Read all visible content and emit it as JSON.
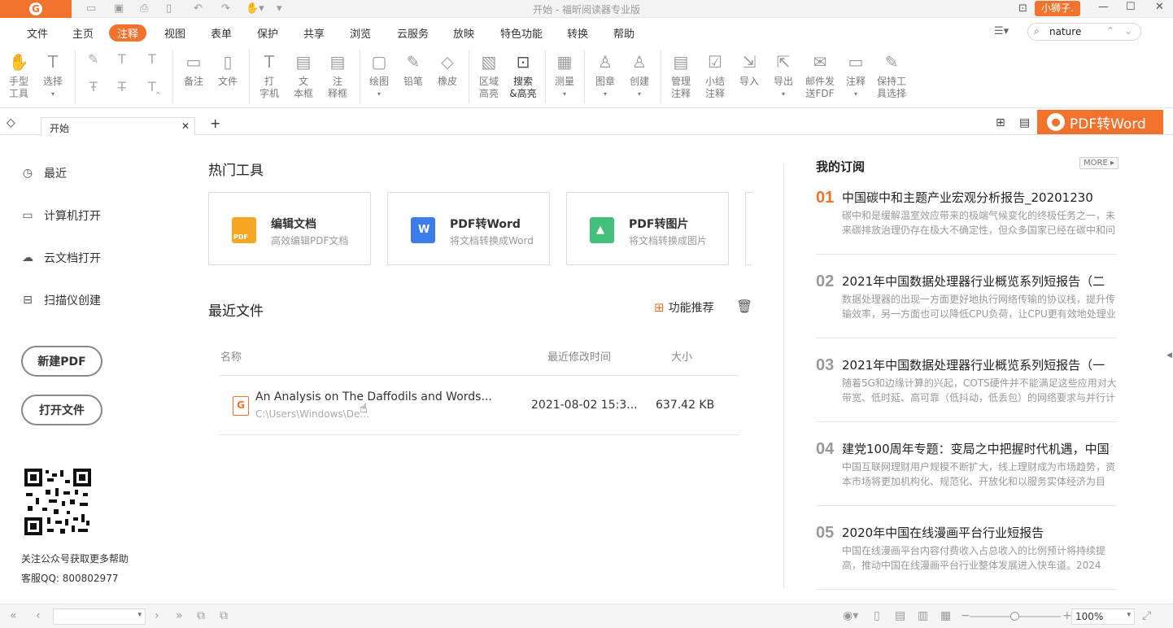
{
  "window": {
    "title": "开始 - 福昕阅读器专业版",
    "user": "小狮子."
  },
  "menu": {
    "items": [
      "文件",
      "主页",
      "注释",
      "视图",
      "表单",
      "保护",
      "共享",
      "浏览",
      "云服务",
      "放映",
      "特色功能",
      "转换",
      "帮助"
    ],
    "active": "注释",
    "search_value": "nature"
  },
  "ribbon": {
    "tools": [
      {
        "label": "手型\n工具",
        "icon": "hand-icon"
      },
      {
        "label": "选择",
        "icon": "select-text-icon"
      },
      {
        "label": "备注",
        "icon": "note-icon"
      },
      {
        "label": "文件",
        "icon": "file-attach-icon"
      },
      {
        "label": "打\n字机",
        "icon": "typewriter-icon"
      },
      {
        "label": "文\n本框",
        "icon": "textbox-icon"
      },
      {
        "label": "注\n释框",
        "icon": "callout-icon"
      },
      {
        "label": "绘图",
        "icon": "drawing-icon"
      },
      {
        "label": "铅笔",
        "icon": "pencil-icon"
      },
      {
        "label": "橡皮",
        "icon": "eraser-icon"
      },
      {
        "label": "区域\n高亮",
        "icon": "area-highlight-icon"
      },
      {
        "label": "搜索\n&高亮",
        "icon": "search-highlight-icon"
      },
      {
        "label": "测量",
        "icon": "measure-icon"
      },
      {
        "label": "图章",
        "icon": "stamp-icon"
      },
      {
        "label": "创建",
        "icon": "create-stamp-icon"
      },
      {
        "label": "管理\n注释",
        "icon": "manage-comments-icon"
      },
      {
        "label": "小结\n注释",
        "icon": "summarize-comments-icon"
      },
      {
        "label": "导入",
        "icon": "import-icon"
      },
      {
        "label": "导出",
        "icon": "export-icon"
      },
      {
        "label": "邮件发\n送FDF",
        "icon": "email-fdf-icon"
      },
      {
        "label": "注释",
        "icon": "comment-icon"
      },
      {
        "label": "保持工\n具选择",
        "icon": "keep-tool-icon"
      }
    ]
  },
  "tabs": {
    "current": "开始",
    "promo": "PDF转Word"
  },
  "sidebar": {
    "items": [
      {
        "label": "最近",
        "icon": "clock-icon"
      },
      {
        "label": "计算机打开",
        "icon": "computer-icon"
      },
      {
        "label": "云文档打开",
        "icon": "cloud-icon"
      },
      {
        "label": "扫描仪创建",
        "icon": "scanner-icon"
      }
    ],
    "new_pdf": "新建PDF",
    "open_file": "打开文件",
    "qr_caption": "关注公众号获取更多帮助",
    "support": "客服QQ: 800802977"
  },
  "hot_tools": {
    "heading": "热门工具",
    "cards": [
      {
        "title": "编辑文档",
        "desc": "高效编辑PDF文档",
        "color": "#f5a623",
        "icon": "edit-pdf-icon",
        "badge": "PDF"
      },
      {
        "title": "PDF转Word",
        "desc": "将文档转换成Word",
        "color": "#3b7de9",
        "icon": "word-icon",
        "badge": "W"
      },
      {
        "title": "PDF转图片",
        "desc": "将文档转换成图片",
        "color": "#45c07a",
        "icon": "image-icon",
        "badge": "▲"
      }
    ]
  },
  "recent": {
    "heading": "最近文件",
    "recommend": "功能推荐",
    "columns": {
      "name": "名称",
      "modified": "最近修改时间",
      "size": "大小"
    },
    "files": [
      {
        "name": "An Analysis on The Daffodils and Words...",
        "path": "C:\\Users\\Windows\\De...",
        "modified": "2021-08-02 15:3...",
        "size": "637.42 KB"
      }
    ]
  },
  "subscriptions": {
    "heading": "我的订阅",
    "more": "MORE",
    "items": [
      {
        "num": "01",
        "title": "中国碳中和主题产业宏观分析报告_20201230",
        "desc": "碳中和是缓解温室效应带来的极端气候变化的终极任务之一，未来碳排放治理仍存在极大不确定性，但众多国家已经在碳中和问"
      },
      {
        "num": "02",
        "title": "2021年中国数据处理器行业概览系列短报告（二",
        "desc": "数据处理器的出现一方面更好地执行网络传输的协议栈，提升传输效率，另一方面也可以降低CPU负荷，让CPU更有效地处理业"
      },
      {
        "num": "03",
        "title": "2021年中国数据处理器行业概览系列短报告（一",
        "desc": "随着5G和边缘计算的兴起，COTS硬件并不能满足这些应用对大带宽、低时延、高可靠（低抖动，低丢包）的网络要求与并行计"
      },
      {
        "num": "04",
        "title": "建党100周年专题：变局之中把握时代机遇，中国",
        "desc": "中国互联网理财用户规模不断扩大，线上理财成为市场趋势，资本市场将更加机构化、规范化、开放化和以服务实体经济为目"
      },
      {
        "num": "05",
        "title": "2020年中国在线漫画平台行业短报告",
        "desc": "中国在线漫画平台内容付费收入占总收入的比例预计将持续提高，推动中国在线漫画平台行业整体发展进入快车道。2024"
      }
    ]
  },
  "statusbar": {
    "zoom": "100%"
  }
}
